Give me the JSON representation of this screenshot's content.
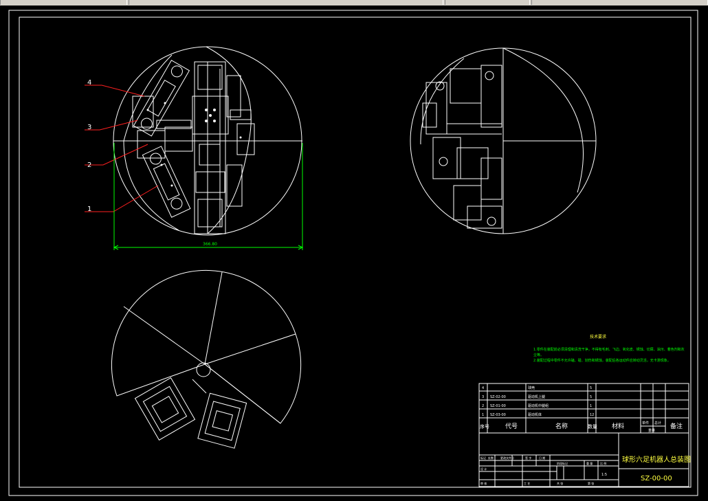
{
  "app": {
    "title_bar_segments": 4
  },
  "drawing": {
    "dimension_text": "366.80",
    "balloons": [
      "1",
      "2",
      "3",
      "4"
    ],
    "tech_requirements": {
      "title": "技术要求",
      "line1": "1.零件在装配前必须清理和清洗干净，不得有毛刺、飞边、氧化皮、锈蚀、切屑、油污、着色剂和灰",
      "line2": "尘等。",
      "line3": "2.装配过程中零件不允许磕、碰、划伤和锈蚀，装配后各运动件应转动灵活，无卡滞现象。"
    },
    "bom": {
      "rows": [
        {
          "no": "4",
          "code": "",
          "name": "球壳",
          "qty": "5"
        },
        {
          "no": "3",
          "code": "SZ-02-00",
          "name": "驱动机上腿",
          "qty": "5"
        },
        {
          "no": "2",
          "code": "SZ-01-00",
          "name": "驱动机中腿组",
          "qty": "1"
        },
        {
          "no": "1",
          "code": "SZ-03-00",
          "name": "驱动机体",
          "qty": "12"
        }
      ],
      "header": {
        "no": "序号",
        "code": "代号",
        "name": "名称",
        "qty": "数量",
        "material": "材料",
        "single_weight": "单件",
        "total_weight": "总计",
        "weight": "重量",
        "remark": "备注"
      }
    },
    "title_block": {
      "drawing_title": "球形六足机器人总装图",
      "drawing_number": "SZ-00-00",
      "scale": "1:5",
      "small_labels": [
        "标记",
        "处数",
        "更改文件号",
        "签 字",
        "日 期",
        "设 计",
        "审 核",
        "工 艺",
        "阶段标记",
        "重 量",
        "比 例",
        "共 张",
        "第 张"
      ]
    }
  },
  "colors": {
    "background": "#000000",
    "line": "#ffffff",
    "leader": "#ff2020",
    "dimension": "#00ff00",
    "text_green": "#00ff00",
    "text_yellow": "#ffff40"
  }
}
